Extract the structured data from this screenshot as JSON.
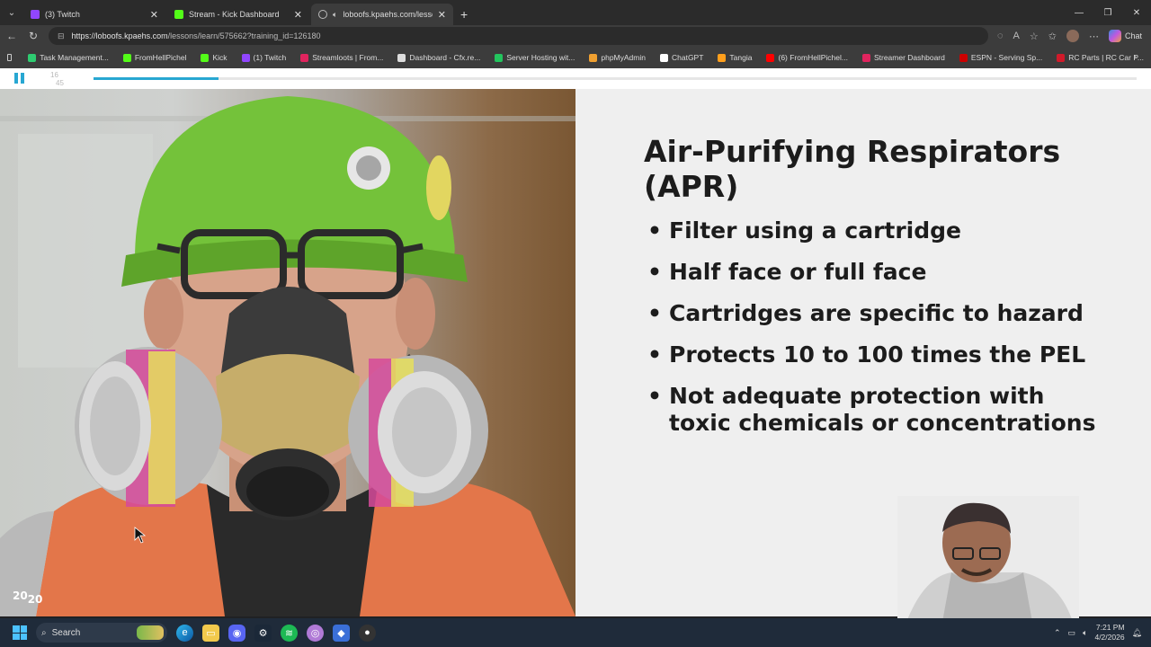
{
  "tabs": [
    {
      "title": "(3) Twitch",
      "color": "#9146ff",
      "active": false
    },
    {
      "title": "Stream - Kick Dashboard",
      "color": "#53fc18",
      "active": false
    },
    {
      "title": "loboofs.kpaehs.com/lessons/l",
      "color": "#9aa0a6",
      "active": true
    }
  ],
  "address": {
    "host": "https://loboofs.kpaehs.com",
    "path": "/lessons/learn/575662?training_id=126180"
  },
  "toolbar": {
    "chat_label": "Chat"
  },
  "bookmarks": [
    {
      "label": "Task Management...",
      "color": "#2ecc71"
    },
    {
      "label": "FromHellPichel",
      "color": "#53fc18"
    },
    {
      "label": "Kick",
      "color": "#53fc18"
    },
    {
      "label": "(1) Twitch",
      "color": "#9146ff"
    },
    {
      "label": "Streamloots | From...",
      "color": "#e0245e"
    },
    {
      "label": "Dashboard - Cfx.re...",
      "color": "#dddddd"
    },
    {
      "label": "Server Hosting wit...",
      "color": "#23c55e"
    },
    {
      "label": "phpMyAdmin",
      "color": "#f0a030"
    },
    {
      "label": "ChatGPT",
      "color": "#ffffff"
    },
    {
      "label": "Tangia",
      "color": "#ff9f1c"
    },
    {
      "label": "(6) FromHellPichel...",
      "color": "#ff0000"
    },
    {
      "label": "Streamer Dashboard",
      "color": "#e0245e"
    },
    {
      "label": "ESPN - Serving Sp...",
      "color": "#cc0000"
    },
    {
      "label": "RC Parts | RC Car P...",
      "color": "#d11a2a"
    }
  ],
  "player": {
    "current": "16",
    "total": "45",
    "progress_fraction": 0.1198,
    "accent": "#28a7d2"
  },
  "slide": {
    "title": "Air-Purifying Respirators (APR)",
    "bullets": [
      "Filter using a cartridge",
      "Half face or full face",
      "Cartridges are specific to hazard",
      "Protects 10 to 100 times the PEL",
      "Not adequate protection with toxic chemicals or concentrations"
    ],
    "logo_a": "20",
    "logo_b": "20"
  },
  "taskbar": {
    "search_label": "Search",
    "time": "7:21 PM",
    "date": "4/2/2026"
  }
}
